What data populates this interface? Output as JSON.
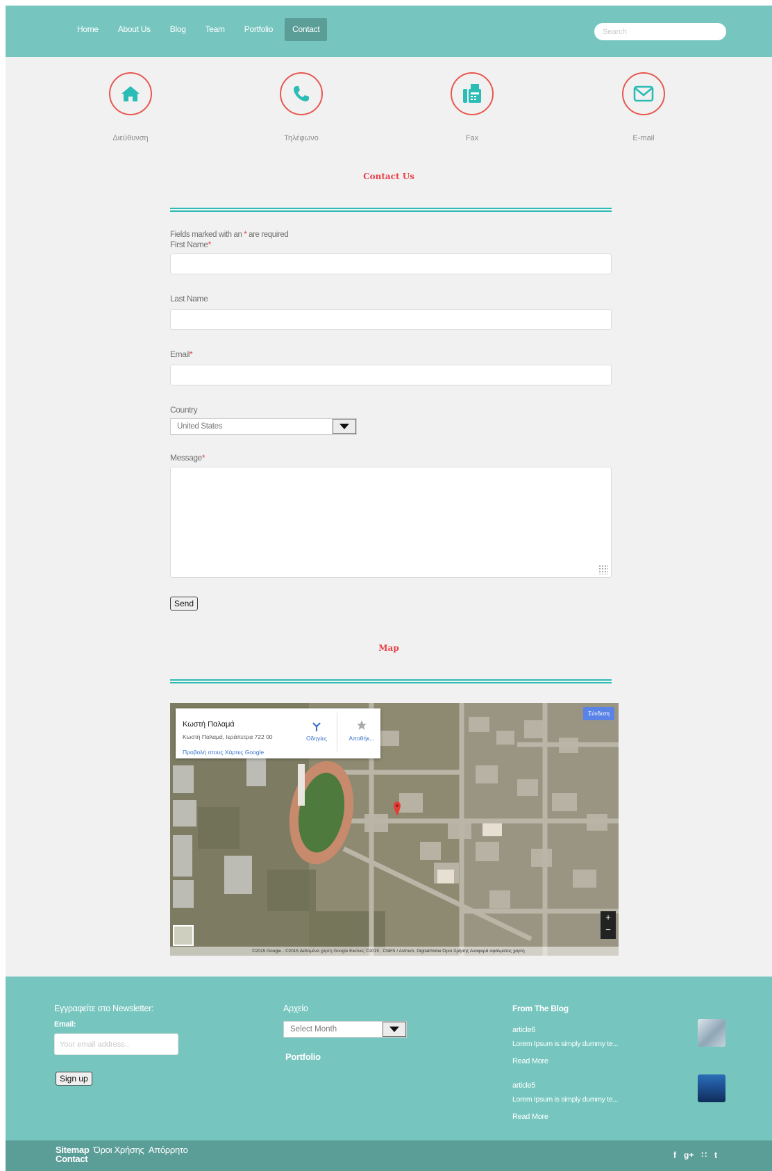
{
  "nav": {
    "items": [
      "Home",
      "About Us",
      "Blog",
      "Team",
      "Portfolio",
      "Contact"
    ],
    "active_index": 5,
    "search_placeholder": "Search"
  },
  "contact_icons": [
    {
      "icon": "home-icon",
      "label": "Διεύθυνση"
    },
    {
      "icon": "phone-icon",
      "label": "Τηλέφωνο"
    },
    {
      "icon": "fax-icon",
      "label": "Fax"
    },
    {
      "icon": "email-icon",
      "label": "E-mail"
    }
  ],
  "contact_title": "Contact Us",
  "form": {
    "required_note_prefix": "Fields marked with an",
    "required_note_star": "*",
    "required_note_suffix": "are required",
    "first_name_label": "First Name",
    "last_name_label": "Last Name",
    "email_label": "Email",
    "country_label": "Country",
    "country_value": "United States",
    "message_label": "Message",
    "required_star": "*",
    "send_label": "Send"
  },
  "map_title": "Map",
  "map": {
    "place_title": "Κωστή Παλαμά",
    "place_address": "Κωστή Παλαμά, Ιεράπετρα 722 00",
    "view_link": "Προβολή στους Χάρτες Google",
    "directions_label": "Οδηγίες",
    "save_label": "Αποθήκ...",
    "login_label": "Σύνδεση",
    "zoom_in": "+",
    "zoom_out": "−",
    "attribution": "©2015 Google - ©2015 Δεδομένα χάρτη Google Εικόνες ©2015 , CNES / Astrium, DigitalGlobe   Όροι Χρήσης   Αναφορά σφάλματος χάρτη"
  },
  "footer": {
    "newsletter_title": "Εγγραφείτε στο Newsletter:",
    "email_label": "Email:",
    "email_placeholder": "Your email address..",
    "signup_label": "Sign up",
    "archive_title": "Αρχείο",
    "archive_select": "Select Month",
    "portfolio_title": "Portfolio",
    "blog_title": "From The Blog",
    "articles": [
      {
        "title": "article6",
        "excerpt": "Lorem Ipsum is simply dummy te...",
        "read_more": "Read More"
      },
      {
        "title": "article5",
        "excerpt": "Lorem Ipsum is simply dummy te...",
        "read_more": "Read More"
      }
    ],
    "bottom_links": [
      "Sitemap",
      "Όροι Χρήσης",
      "Απόρρητο",
      "Contact"
    ],
    "social": [
      "f",
      "g+",
      "rss",
      "t"
    ]
  },
  "colors": {
    "teal": "#76c6bf",
    "teal_dark": "#5b9d97",
    "accent_red": "#e8434a",
    "divider_teal": "#2bbcb5",
    "background": "#f1f1f1"
  }
}
